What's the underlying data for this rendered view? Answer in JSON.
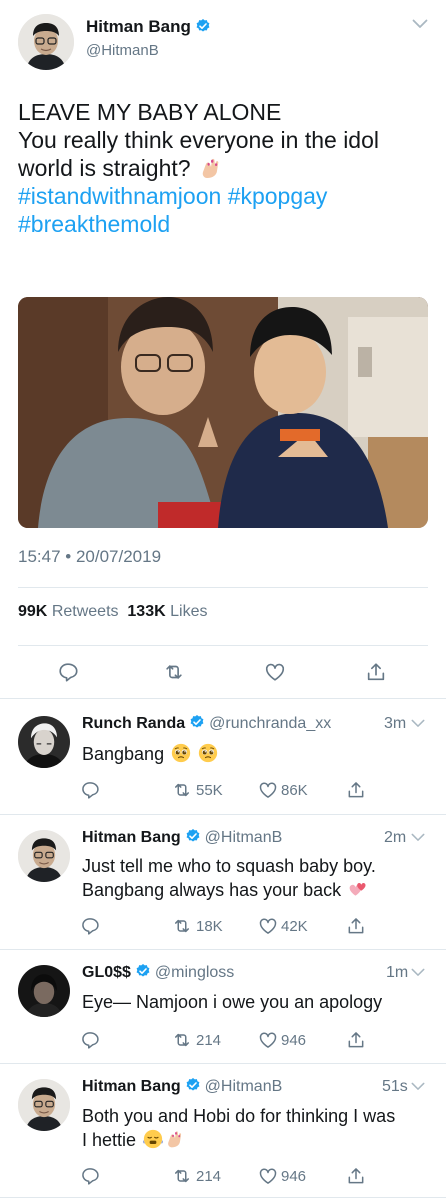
{
  "colors": {
    "accent": "#1da1f2",
    "text": "#14171a",
    "muted": "#657786",
    "divider": "#e1e8ed",
    "heart": "#e0245e"
  },
  "tweet": {
    "author_name": "Hitman Bang",
    "author_handle": "@HitmanB",
    "text_lines": [
      "LEAVE MY BABY ALONE",
      "You really think everyone in the idol",
      "world is straight?"
    ],
    "hashtags": [
      "#istandwithnamjoon",
      "#kpopgay",
      "#breakthemold"
    ],
    "timestamp": "15:47 • 20/07/2019",
    "retweets_count": "99K",
    "retweets_label": "Retweets",
    "likes_count": "133K",
    "likes_label": "Likes"
  },
  "actions": [
    "reply-icon",
    "retweet-icon",
    "like-icon",
    "share-icon"
  ],
  "replies": [
    {
      "name": "Runch Randa",
      "handle": "@runchranda_xx",
      "time": "3m",
      "text_lines": [
        "Bangbang"
      ],
      "retweets": "55K",
      "likes": "86K"
    },
    {
      "name": "Hitman Bang",
      "handle": "@HitmanB",
      "time": "2m",
      "text_lines": [
        "Just tell me who to squash baby boy.",
        "Bangbang always has your back"
      ],
      "retweets": "18K",
      "likes": "42K"
    },
    {
      "name": "GL0$$",
      "handle": "@mingloss",
      "time": "1m",
      "text_lines": [
        "Eye— Namjoon i owe you an apology"
      ],
      "retweets": "214",
      "likes": "946"
    },
    {
      "name": "Hitman Bang",
      "handle": "@HitmanB",
      "time": "51s",
      "text_lines": [
        "Both you and Hobi do for thinking I was",
        "I hettie"
      ],
      "retweets": "214",
      "likes": "946"
    }
  ]
}
